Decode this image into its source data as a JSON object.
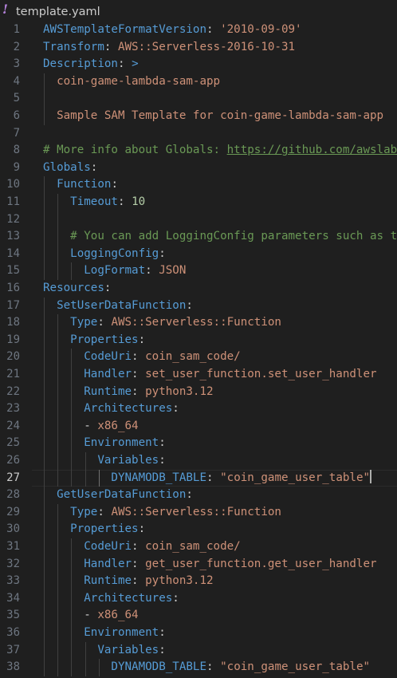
{
  "tab": {
    "icon": "!",
    "title": "template.yaml"
  },
  "editor": {
    "current_line": 27,
    "lines": [
      {
        "n": "1",
        "indent": 0,
        "tokens": [
          {
            "t": "AWSTemplateFormatVersion",
            "c": "k"
          },
          {
            "t": ": ",
            "c": "p"
          },
          {
            "t": "'2010-09-09'",
            "c": "s"
          }
        ]
      },
      {
        "n": "2",
        "indent": 0,
        "tokens": [
          {
            "t": "Transform",
            "c": "k"
          },
          {
            "t": ": ",
            "c": "p"
          },
          {
            "t": "AWS::Serverless-2016-10-31",
            "c": "s"
          }
        ]
      },
      {
        "n": "3",
        "indent": 0,
        "tokens": [
          {
            "t": "Description",
            "c": "k"
          },
          {
            "t": ": ",
            "c": "p"
          },
          {
            "t": ">",
            "c": "k"
          }
        ]
      },
      {
        "n": "4",
        "indent": 1,
        "tokens": [
          {
            "t": "  coin-game-lambda-sam-app",
            "c": "s"
          }
        ]
      },
      {
        "n": "5",
        "indent": 1,
        "tokens": []
      },
      {
        "n": "6",
        "indent": 1,
        "tokens": [
          {
            "t": "  Sample SAM Template for coin-game-lambda-sam-app",
            "c": "s"
          }
        ]
      },
      {
        "n": "7",
        "indent": 0,
        "tokens": []
      },
      {
        "n": "8",
        "indent": 0,
        "tokens": [
          {
            "t": "# More info about Globals: ",
            "c": "c"
          },
          {
            "t": "https://github.com/awslabs/serverless-application-model",
            "c": "u"
          }
        ]
      },
      {
        "n": "9",
        "indent": 0,
        "tokens": [
          {
            "t": "Globals",
            "c": "k"
          },
          {
            "t": ":",
            "c": "p"
          }
        ]
      },
      {
        "n": "10",
        "indent": 1,
        "tokens": [
          {
            "t": "  ",
            "c": "p"
          },
          {
            "t": "Function",
            "c": "k"
          },
          {
            "t": ":",
            "c": "p"
          }
        ]
      },
      {
        "n": "11",
        "indent": 2,
        "tokens": [
          {
            "t": "    ",
            "c": "p"
          },
          {
            "t": "Timeout",
            "c": "k"
          },
          {
            "t": ": ",
            "c": "p"
          },
          {
            "t": "10",
            "c": "n"
          }
        ]
      },
      {
        "n": "12",
        "indent": 2,
        "tokens": []
      },
      {
        "n": "13",
        "indent": 2,
        "tokens": [
          {
            "t": "    # You can add LoggingConfig parameters such as the Logformat",
            "c": "c"
          }
        ]
      },
      {
        "n": "14",
        "indent": 2,
        "tokens": [
          {
            "t": "    ",
            "c": "p"
          },
          {
            "t": "LoggingConfig",
            "c": "k"
          },
          {
            "t": ":",
            "c": "p"
          }
        ]
      },
      {
        "n": "15",
        "indent": 3,
        "tokens": [
          {
            "t": "      ",
            "c": "p"
          },
          {
            "t": "LogFormat",
            "c": "k"
          },
          {
            "t": ": ",
            "c": "p"
          },
          {
            "t": "JSON",
            "c": "s"
          }
        ]
      },
      {
        "n": "16",
        "indent": 0,
        "tokens": [
          {
            "t": "Resources",
            "c": "k"
          },
          {
            "t": ":",
            "c": "p"
          }
        ]
      },
      {
        "n": "17",
        "indent": 1,
        "tokens": [
          {
            "t": "  ",
            "c": "p"
          },
          {
            "t": "SetUserDataFunction",
            "c": "k"
          },
          {
            "t": ":",
            "c": "p"
          }
        ]
      },
      {
        "n": "18",
        "indent": 2,
        "tokens": [
          {
            "t": "    ",
            "c": "p"
          },
          {
            "t": "Type",
            "c": "k"
          },
          {
            "t": ": ",
            "c": "p"
          },
          {
            "t": "AWS::Serverless::Function",
            "c": "s"
          }
        ]
      },
      {
        "n": "19",
        "indent": 2,
        "tokens": [
          {
            "t": "    ",
            "c": "p"
          },
          {
            "t": "Properties",
            "c": "k"
          },
          {
            "t": ":",
            "c": "p"
          }
        ]
      },
      {
        "n": "20",
        "indent": 3,
        "tokens": [
          {
            "t": "      ",
            "c": "p"
          },
          {
            "t": "CodeUri",
            "c": "k"
          },
          {
            "t": ": ",
            "c": "p"
          },
          {
            "t": "coin_sam_code/",
            "c": "s"
          }
        ]
      },
      {
        "n": "21",
        "indent": 3,
        "tokens": [
          {
            "t": "      ",
            "c": "p"
          },
          {
            "t": "Handler",
            "c": "k"
          },
          {
            "t": ": ",
            "c": "p"
          },
          {
            "t": "set_user_function.set_user_handler",
            "c": "s"
          }
        ]
      },
      {
        "n": "22",
        "indent": 3,
        "tokens": [
          {
            "t": "      ",
            "c": "p"
          },
          {
            "t": "Runtime",
            "c": "k"
          },
          {
            "t": ": ",
            "c": "p"
          },
          {
            "t": "python3.12",
            "c": "s"
          }
        ]
      },
      {
        "n": "23",
        "indent": 3,
        "tokens": [
          {
            "t": "      ",
            "c": "p"
          },
          {
            "t": "Architectures",
            "c": "k"
          },
          {
            "t": ":",
            "c": "p"
          }
        ]
      },
      {
        "n": "24",
        "indent": 3,
        "tokens": [
          {
            "t": "      - ",
            "c": "p"
          },
          {
            "t": "x86_64",
            "c": "s"
          }
        ]
      },
      {
        "n": "25",
        "indent": 3,
        "tokens": [
          {
            "t": "      ",
            "c": "p"
          },
          {
            "t": "Environment",
            "c": "k"
          },
          {
            "t": ":",
            "c": "p"
          }
        ]
      },
      {
        "n": "26",
        "indent": 4,
        "tokens": [
          {
            "t": "        ",
            "c": "p"
          },
          {
            "t": "Variables",
            "c": "k"
          },
          {
            "t": ":",
            "c": "p"
          }
        ]
      },
      {
        "n": "27",
        "indent": 5,
        "tokens": [
          {
            "t": "          ",
            "c": "p"
          },
          {
            "t": "DYNAMODB_TABLE",
            "c": "k"
          },
          {
            "t": ": ",
            "c": "p"
          },
          {
            "t": "\"coin_game_user_table\"",
            "c": "s"
          }
        ]
      },
      {
        "n": "28",
        "indent": 1,
        "tokens": [
          {
            "t": "  ",
            "c": "p"
          },
          {
            "t": "GetUserDataFunction",
            "c": "k"
          },
          {
            "t": ":",
            "c": "p"
          }
        ]
      },
      {
        "n": "29",
        "indent": 2,
        "tokens": [
          {
            "t": "    ",
            "c": "p"
          },
          {
            "t": "Type",
            "c": "k"
          },
          {
            "t": ": ",
            "c": "p"
          },
          {
            "t": "AWS::Serverless::Function",
            "c": "s"
          }
        ]
      },
      {
        "n": "30",
        "indent": 2,
        "tokens": [
          {
            "t": "    ",
            "c": "p"
          },
          {
            "t": "Properties",
            "c": "k"
          },
          {
            "t": ":",
            "c": "p"
          }
        ]
      },
      {
        "n": "31",
        "indent": 3,
        "tokens": [
          {
            "t": "      ",
            "c": "p"
          },
          {
            "t": "CodeUri",
            "c": "k"
          },
          {
            "t": ": ",
            "c": "p"
          },
          {
            "t": "coin_sam_code/",
            "c": "s"
          }
        ]
      },
      {
        "n": "32",
        "indent": 3,
        "tokens": [
          {
            "t": "      ",
            "c": "p"
          },
          {
            "t": "Handler",
            "c": "k"
          },
          {
            "t": ": ",
            "c": "p"
          },
          {
            "t": "get_user_function.get_user_handler",
            "c": "s"
          }
        ]
      },
      {
        "n": "33",
        "indent": 3,
        "tokens": [
          {
            "t": "      ",
            "c": "p"
          },
          {
            "t": "Runtime",
            "c": "k"
          },
          {
            "t": ": ",
            "c": "p"
          },
          {
            "t": "python3.12",
            "c": "s"
          }
        ]
      },
      {
        "n": "34",
        "indent": 3,
        "tokens": [
          {
            "t": "      ",
            "c": "p"
          },
          {
            "t": "Architectures",
            "c": "k"
          },
          {
            "t": ":",
            "c": "p"
          }
        ]
      },
      {
        "n": "35",
        "indent": 3,
        "tokens": [
          {
            "t": "      - ",
            "c": "p"
          },
          {
            "t": "x86_64",
            "c": "s"
          }
        ]
      },
      {
        "n": "36",
        "indent": 3,
        "tokens": [
          {
            "t": "      ",
            "c": "p"
          },
          {
            "t": "Environment",
            "c": "k"
          },
          {
            "t": ":",
            "c": "p"
          }
        ]
      },
      {
        "n": "37",
        "indent": 4,
        "tokens": [
          {
            "t": "        ",
            "c": "p"
          },
          {
            "t": "Variables",
            "c": "k"
          },
          {
            "t": ":",
            "c": "p"
          }
        ]
      },
      {
        "n": "38",
        "indent": 5,
        "tokens": [
          {
            "t": "          ",
            "c": "p"
          },
          {
            "t": "DYNAMODB_TABLE",
            "c": "k"
          },
          {
            "t": ": ",
            "c": "p"
          },
          {
            "t": "\"coin_game_user_table\"",
            "c": "s"
          }
        ]
      }
    ]
  }
}
